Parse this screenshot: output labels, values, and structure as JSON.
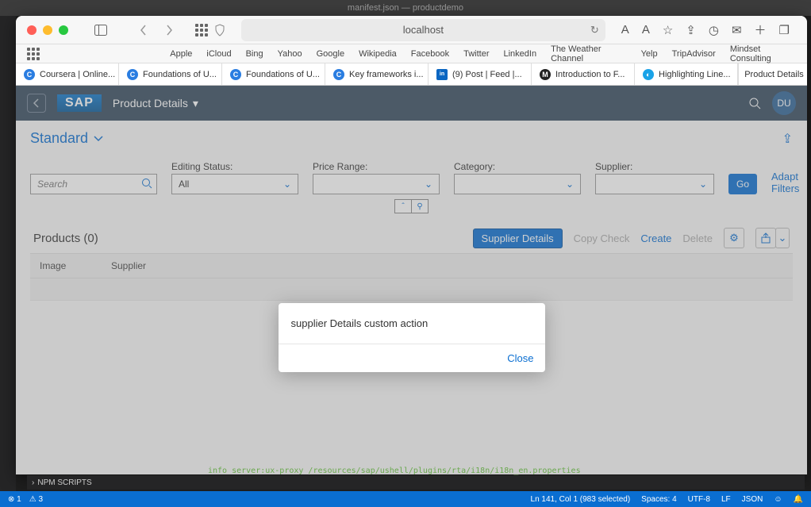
{
  "mac_title": "manifest.json — productdemo",
  "address_bar": {
    "url_display": "localhost"
  },
  "bookmarks": [
    "Apple",
    "iCloud",
    "Bing",
    "Yahoo",
    "Google",
    "Wikipedia",
    "Facebook",
    "Twitter",
    "LinkedIn",
    "The Weather Channel",
    "Yelp",
    "TripAdvisor",
    "Mindset Consulting"
  ],
  "tabs": [
    {
      "label": "Coursera | Online...",
      "favicon": "C",
      "color": "#2a7de1"
    },
    {
      "label": "Foundations of U...",
      "favicon": "C",
      "color": "#2a7de1"
    },
    {
      "label": "Foundations of U...",
      "favicon": "C",
      "color": "#2a7de1"
    },
    {
      "label": "Key frameworks i...",
      "favicon": "C",
      "color": "#2a7de1"
    },
    {
      "label": "(9) Post | Feed |...",
      "favicon": "in",
      "color": "#0a66c2"
    },
    {
      "label": "Introduction to F...",
      "favicon": "M",
      "color": "#222"
    },
    {
      "label": "Highlighting Line...",
      "favicon": "◐",
      "color": "#1aa3e8"
    }
  ],
  "active_tab_right": "Product Details",
  "sap": {
    "logo": "SAP",
    "title": "Product Details",
    "avatar": "DU",
    "variant": "Standard",
    "filters": {
      "search_placeholder": "Search",
      "editing_label": "Editing Status:",
      "editing_value": "All",
      "price_label": "Price Range:",
      "category_label": "Category:",
      "supplier_label": "Supplier:",
      "go": "Go",
      "adapt": "Adapt Filters"
    },
    "table": {
      "title": "Products (0)",
      "actions": {
        "supplier_details": "Supplier Details",
        "copy_check": "Copy Check",
        "create": "Create",
        "delete": "Delete"
      },
      "columns": [
        "Image",
        "Supplier"
      ]
    }
  },
  "dialog": {
    "message": "supplier Details custom action",
    "close": "Close"
  },
  "vscode": {
    "npm": "NPM SCRIPTS",
    "terminal": "info server:ux-proxy /resources/sap/ushell/plugins/rta/i18n/i18n_en.properties",
    "problems": "1",
    "warnings": "3",
    "cursor": "Ln 141, Col 1 (983 selected)",
    "spaces": "Spaces: 4",
    "encoding": "UTF-8",
    "eol": "LF",
    "lang": "JSON"
  }
}
